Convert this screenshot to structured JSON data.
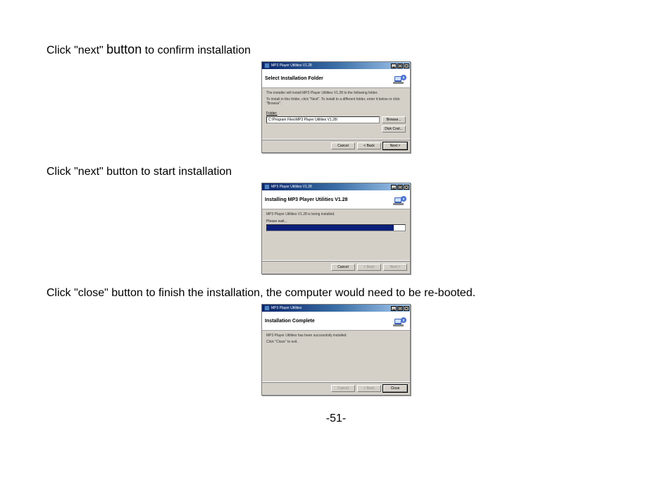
{
  "instructions": {
    "step1_pre": "Click \"next\" ",
    "step1_bump": "button",
    "step1_post": " to confirm installation",
    "step2": "Click \"next\" button to start installation",
    "step3": "Click \"close\" button to finish the installation, the computer would need to be re-booted."
  },
  "page_number": "-51-",
  "dialog1": {
    "title": "MP3 Player Utilities V1.28",
    "heading": "Select Installation Folder",
    "line1": "The installer will install MP3 Player Utilities V1.28 to the following folder.",
    "line2": "To install in this folder, click \"Next\". To install to a different folder, enter it below or click \"Browse\".",
    "folder_label": "Folder:",
    "folder_value": "C:\\Program Files\\MP3 Player Utilities V1.28\\",
    "browse": "Browse...",
    "disk_cost": "Disk Cost...",
    "cancel": "Cancel",
    "back": "< Back",
    "next": "Next >"
  },
  "dialog2": {
    "title": "MP3 Player Utilities V1.28",
    "heading": "Installing MP3 Player Utilities V1.28",
    "line1": "MP3 Player Utilities V1.28 is being installed.",
    "progress_label": "Please wait...",
    "progress_percent": 92,
    "cancel": "Cancel",
    "back": "< Back",
    "next": "Next >"
  },
  "dialog3": {
    "title": "MP3 Player Utilities",
    "heading": "Installation Complete",
    "line1": "MP3 Player Utilities has been successfully installed.",
    "line2": "Click \"Close\" to exit.",
    "cancel": "Cancel",
    "back": "< Back",
    "close": "Close"
  }
}
